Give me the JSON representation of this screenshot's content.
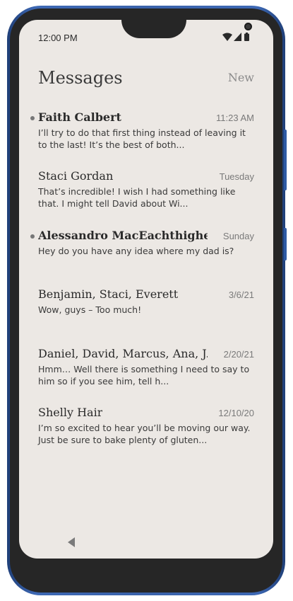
{
  "status": {
    "time": "12:00 PM"
  },
  "header": {
    "title": "Messages",
    "new_label": "New"
  },
  "messages": [
    {
      "name": "Faith Calbert",
      "time": "11:23 AM",
      "preview": "I’ll try to do that first thing instead of leaving it to the last! It’s the best of both...",
      "unread": true
    },
    {
      "name": "Staci Gordan",
      "time": "Tuesday",
      "preview": "That’s incredible! I wish I had something like that. I might tell David about Wi...",
      "unread": false
    },
    {
      "name": "Alessandro  MacEachthighe...",
      "time": "Sunday",
      "preview": "Hey do you have any idea where my dad is?",
      "unread": true
    },
    {
      "name": "Benjamin, Staci, Everett",
      "time": "3/6/21",
      "preview": "Wow, guys – Too much!",
      "unread": false
    },
    {
      "name": "Daniel, David, Marcus, Ana, J...",
      "time": "2/20/21",
      "preview": "Hmm… Well there is something I need to say to him so if you see him, tell h...",
      "unread": false
    },
    {
      "name": "Shelly Hair",
      "time": "12/10/20",
      "preview": "I’m so excited to hear you’ll be moving our way. Just be sure to bake plenty of gluten...",
      "unread": false
    }
  ],
  "icons": {
    "back": "back-triangle-icon",
    "wifi": "wifi-icon",
    "signal": "signal-icon",
    "battery": "battery-icon"
  },
  "colors": {
    "screen_bg": "#ece8e4",
    "frame": "#3a62aa",
    "text": "#2a2a2a",
    "muted": "#7a7a7a"
  }
}
